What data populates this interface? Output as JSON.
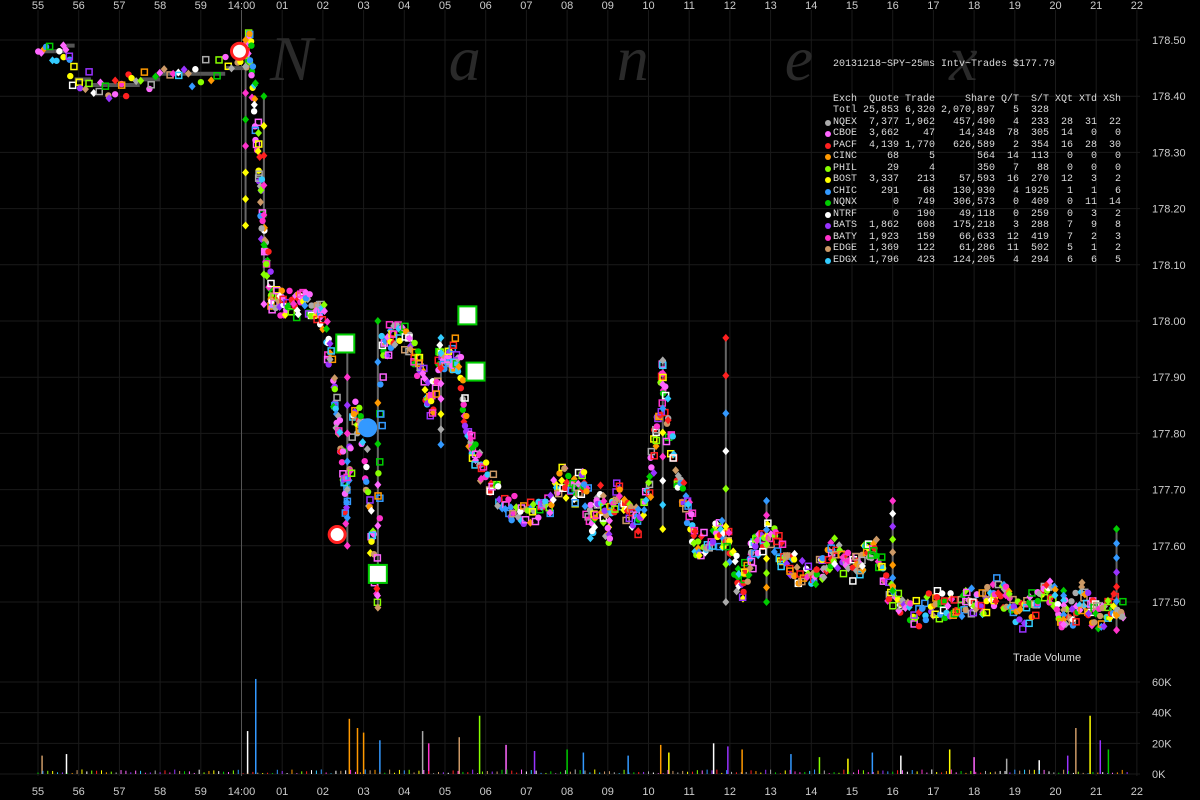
{
  "watermark": "N a n e x",
  "chart_data": {
    "type": "scatter",
    "title": "20131218~SPY~25ms Intv~Trades $177.79",
    "x_ticks_top": [
      "55",
      "56",
      "57",
      "58",
      "59",
      "14:00",
      "01",
      "02",
      "03",
      "04",
      "05",
      "06",
      "07",
      "08",
      "09",
      "10",
      "11",
      "12",
      "13",
      "14",
      "15",
      "16",
      "17",
      "18",
      "19",
      "20",
      "21",
      "22"
    ],
    "x_ticks_bottom": [
      "55",
      "56",
      "57",
      "58",
      "59",
      "14:00",
      "01",
      "02",
      "03",
      "04",
      "05",
      "06",
      "07",
      "08",
      "09",
      "10",
      "11",
      "12",
      "13",
      "14",
      "15",
      "16",
      "17",
      "18",
      "19",
      "20",
      "21",
      "22"
    ],
    "y_ticks": [
      "178.50",
      "178.40",
      "178.30",
      "178.20",
      "178.10",
      "178.00",
      "177.90",
      "177.80",
      "177.70",
      "177.60",
      "177.50"
    ],
    "ylim": [
      177.43,
      178.52
    ],
    "volume_label": "Trade Volume",
    "volume_ticks": [
      "60K",
      "40K",
      "20K",
      "0K"
    ],
    "volume_ylim": [
      0,
      70000
    ],
    "table_header": [
      "Exch",
      "Quote",
      "Trade",
      "Share",
      "Q/T",
      "S/T",
      "XQt",
      "XTd",
      "XSh"
    ],
    "table_rows": [
      {
        "exch": "Totl",
        "quote": "25,853",
        "trade": "6,320",
        "share": "2,070,897",
        "qt": "5",
        "st": "328",
        "xqt": "",
        "xtd": "",
        "xsh": "",
        "color": ""
      },
      {
        "exch": "NQEX",
        "quote": "7,377",
        "trade": "1,962",
        "share": "457,490",
        "qt": "4",
        "st": "233",
        "xqt": "28",
        "xtd": "31",
        "xsh": "22",
        "color": "#aaaaaa"
      },
      {
        "exch": "CBOE",
        "quote": "3,662",
        "trade": "47",
        "share": "14,348",
        "qt": "78",
        "st": "305",
        "xqt": "14",
        "xtd": "0",
        "xsh": "0",
        "color": "#ff66ff"
      },
      {
        "exch": "PACF",
        "quote": "4,139",
        "trade": "1,770",
        "share": "626,589",
        "qt": "2",
        "st": "354",
        "xqt": "16",
        "xtd": "28",
        "xsh": "30",
        "color": "#ff2020"
      },
      {
        "exch": "CINC",
        "quote": "68",
        "trade": "5",
        "share": "564",
        "qt": "14",
        "st": "113",
        "xqt": "0",
        "xtd": "0",
        "xsh": "0",
        "color": "#ff9900"
      },
      {
        "exch": "PHIL",
        "quote": "29",
        "trade": "4",
        "share": "350",
        "qt": "7",
        "st": "88",
        "xqt": "0",
        "xtd": "0",
        "xsh": "0",
        "color": "#88ff00"
      },
      {
        "exch": "BOST",
        "quote": "3,337",
        "trade": "213",
        "share": "57,593",
        "qt": "16",
        "st": "270",
        "xqt": "12",
        "xtd": "3",
        "xsh": "2",
        "color": "#ffff00"
      },
      {
        "exch": "CHIC",
        "quote": "291",
        "trade": "68",
        "share": "130,930",
        "qt": "4",
        "st": "1925",
        "xqt": "1",
        "xtd": "1",
        "xsh": "6",
        "color": "#3399ff"
      },
      {
        "exch": "NQNX",
        "quote": "0",
        "trade": "749",
        "share": "306,573",
        "qt": "0",
        "st": "409",
        "xqt": "0",
        "xtd": "11",
        "xsh": "14",
        "color": "#00cc00"
      },
      {
        "exch": "NTRF",
        "quote": "0",
        "trade": "190",
        "share": "49,118",
        "qt": "0",
        "st": "259",
        "xqt": "0",
        "xtd": "3",
        "xsh": "2",
        "color": "#ffffff"
      },
      {
        "exch": "BATS",
        "quote": "1,862",
        "trade": "608",
        "share": "175,218",
        "qt": "3",
        "st": "288",
        "xqt": "7",
        "xtd": "9",
        "xsh": "8",
        "color": "#9933ff"
      },
      {
        "exch": "BATY",
        "quote": "1,923",
        "trade": "159",
        "share": "66,633",
        "qt": "12",
        "st": "419",
        "xqt": "7",
        "xtd": "2",
        "xsh": "3",
        "color": "#ff33cc"
      },
      {
        "exch": "EDGE",
        "quote": "1,369",
        "trade": "122",
        "share": "61,286",
        "qt": "11",
        "st": "502",
        "xqt": "5",
        "xtd": "1",
        "xsh": "2",
        "color": "#cc9966"
      },
      {
        "exch": "EDGX",
        "quote": "1,796",
        "trade": "423",
        "share": "124,205",
        "qt": "4",
        "st": "294",
        "xqt": "6",
        "xtd": "6",
        "xsh": "5",
        "color": "#33ccff"
      }
    ],
    "price_path": [
      [
        -5.0,
        178.48
      ],
      [
        -4.6,
        178.48
      ],
      [
        -4.3,
        178.49
      ],
      [
        -4.1,
        178.43
      ],
      [
        -3.7,
        178.42
      ],
      [
        -3.3,
        178.42
      ],
      [
        -2.9,
        178.42
      ],
      [
        -2.5,
        178.43
      ],
      [
        -2.0,
        178.44
      ],
      [
        -1.5,
        178.44
      ],
      [
        -1.0,
        178.44
      ],
      [
        -0.4,
        178.45
      ],
      [
        0.1,
        178.47
      ],
      [
        0.2,
        178.5
      ],
      [
        0.35,
        178.38
      ],
      [
        0.45,
        178.25
      ],
      [
        0.55,
        178.15
      ],
      [
        0.7,
        178.05
      ],
      [
        0.9,
        178.03
      ],
      [
        1.2,
        178.03
      ],
      [
        1.5,
        178.03
      ],
      [
        1.8,
        178.02
      ],
      [
        2.0,
        178.01
      ],
      [
        2.2,
        177.93
      ],
      [
        2.35,
        177.82
      ],
      [
        2.5,
        177.76
      ],
      [
        2.6,
        177.65
      ],
      [
        2.75,
        177.85
      ],
      [
        3.0,
        177.8
      ],
      [
        3.2,
        177.62
      ],
      [
        3.35,
        177.5
      ],
      [
        3.45,
        177.95
      ],
      [
        3.7,
        177.97
      ],
      [
        4.0,
        177.97
      ],
      [
        4.3,
        177.94
      ],
      [
        4.5,
        177.88
      ],
      [
        4.7,
        177.85
      ],
      [
        4.9,
        177.95
      ],
      [
        5.1,
        177.93
      ],
      [
        5.3,
        177.95
      ],
      [
        5.5,
        177.82
      ],
      [
        5.7,
        177.76
      ],
      [
        6.0,
        177.73
      ],
      [
        6.4,
        177.68
      ],
      [
        6.8,
        177.66
      ],
      [
        7.2,
        177.66
      ],
      [
        7.6,
        177.68
      ],
      [
        7.9,
        177.72
      ],
      [
        8.2,
        177.69
      ],
      [
        8.4,
        177.73
      ],
      [
        8.6,
        177.63
      ],
      [
        8.8,
        177.7
      ],
      [
        9.0,
        177.62
      ],
      [
        9.2,
        177.7
      ],
      [
        9.5,
        177.66
      ],
      [
        9.7,
        177.64
      ],
      [
        10.0,
        177.69
      ],
      [
        10.2,
        177.8
      ],
      [
        10.35,
        177.92
      ],
      [
        10.5,
        177.8
      ],
      [
        10.7,
        177.72
      ],
      [
        11.0,
        177.66
      ],
      [
        11.2,
        177.6
      ],
      [
        11.5,
        177.62
      ],
      [
        11.8,
        177.62
      ],
      [
        12.0,
        177.6
      ],
      [
        12.3,
        177.52
      ],
      [
        12.5,
        177.58
      ],
      [
        12.7,
        177.6
      ],
      [
        13.0,
        177.62
      ],
      [
        13.3,
        177.58
      ],
      [
        13.6,
        177.56
      ],
      [
        14.0,
        177.55
      ],
      [
        14.3,
        177.56
      ],
      [
        14.5,
        177.6
      ],
      [
        14.8,
        177.57
      ],
      [
        15.1,
        177.56
      ],
      [
        15.3,
        177.58
      ],
      [
        15.6,
        177.6
      ],
      [
        15.9,
        177.52
      ],
      [
        16.2,
        177.49
      ],
      [
        16.6,
        177.48
      ],
      [
        17.0,
        177.5
      ],
      [
        17.3,
        177.49
      ],
      [
        17.7,
        177.5
      ],
      [
        18.0,
        177.5
      ],
      [
        18.3,
        177.5
      ],
      [
        18.6,
        177.52
      ],
      [
        18.9,
        177.5
      ],
      [
        19.2,
        177.47
      ],
      [
        19.5,
        177.5
      ],
      [
        19.8,
        177.52
      ],
      [
        20.1,
        177.48
      ],
      [
        20.4,
        177.48
      ],
      [
        20.7,
        177.52
      ],
      [
        20.9,
        177.48
      ],
      [
        21.1,
        177.47
      ],
      [
        21.4,
        177.5
      ],
      [
        21.7,
        177.49
      ]
    ],
    "spikes": [
      [
        0.1,
        178.5,
        178.17
      ],
      [
        0.55,
        178.4,
        178.03
      ],
      [
        2.6,
        177.95,
        177.6
      ],
      [
        3.35,
        178.0,
        177.49
      ],
      [
        4.9,
        177.97,
        177.78
      ],
      [
        10.35,
        177.93,
        177.63
      ],
      [
        11.9,
        177.97,
        177.5
      ],
      [
        12.9,
        177.68,
        177.5
      ],
      [
        16.0,
        177.68,
        177.52
      ],
      [
        20.2,
        177.52,
        177.46
      ],
      [
        21.5,
        177.63,
        177.45
      ]
    ],
    "big_markers": [
      {
        "x": -0.05,
        "y": 178.48,
        "shape": "circle",
        "color": "#ff2020"
      },
      {
        "x": 2.35,
        "y": 177.62,
        "shape": "circle",
        "color": "#ff2020"
      },
      {
        "x": 2.55,
        "y": 177.96,
        "shape": "square",
        "color": "#00cc00"
      },
      {
        "x": 3.35,
        "y": 177.55,
        "shape": "square",
        "color": "#00cc00"
      },
      {
        "x": 5.75,
        "y": 177.91,
        "shape": "square",
        "color": "#00cc00"
      },
      {
        "x": 5.55,
        "y": 178.01,
        "shape": "square",
        "color": "#00cc00"
      },
      {
        "x": 3.1,
        "y": 177.81,
        "shape": "circle",
        "color": "#3399ff"
      }
    ],
    "volume_spikes": [
      [
        0.35,
        62000
      ],
      [
        0.15,
        28000
      ],
      [
        -4.3,
        13000
      ],
      [
        -4.9,
        12000
      ],
      [
        2.65,
        36000
      ],
      [
        2.85,
        30000
      ],
      [
        3.0,
        27000
      ],
      [
        3.4,
        22000
      ],
      [
        4.45,
        28000
      ],
      [
        4.6,
        20000
      ],
      [
        5.35,
        24000
      ],
      [
        5.85,
        38000
      ],
      [
        6.5,
        19000
      ],
      [
        7.2,
        15000
      ],
      [
        8.0,
        16000
      ],
      [
        8.4,
        14000
      ],
      [
        9.5,
        12000
      ],
      [
        10.3,
        19000
      ],
      [
        10.5,
        14000
      ],
      [
        11.6,
        20000
      ],
      [
        11.95,
        18000
      ],
      [
        12.3,
        16000
      ],
      [
        13.5,
        13000
      ],
      [
        14.2,
        11000
      ],
      [
        14.9,
        10000
      ],
      [
        15.5,
        14000
      ],
      [
        16.2,
        12000
      ],
      [
        17.4,
        16000
      ],
      [
        18.0,
        11000
      ],
      [
        18.8,
        10000
      ],
      [
        19.6,
        9000
      ],
      [
        20.3,
        12000
      ],
      [
        20.5,
        30000
      ],
      [
        20.85,
        38000
      ],
      [
        21.1,
        22000
      ],
      [
        21.3,
        16000
      ]
    ]
  }
}
